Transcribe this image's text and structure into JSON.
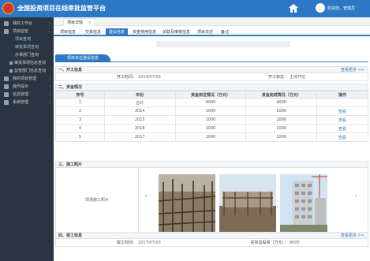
{
  "header": {
    "title": "全国投资项目在线审批监管平台",
    "user": "欢迎您，管理员"
  },
  "sidebar": {
    "items": [
      {
        "label": "我的工作台",
        "icon": "desktop-icon"
      },
      {
        "label": "项目监管",
        "icon": "monitor-icon"
      }
    ],
    "sub_items": [
      "项目查询",
      "审批事项查询",
      "办事部门查询"
    ],
    "sub2_items": [
      "审批事项信息查询",
      "监管部门信息查询"
    ],
    "bottom_items": [
      {
        "label": "我的项目管理",
        "icon": "folder-icon"
      },
      {
        "label": "操作提示",
        "icon": "tips-icon"
      },
      {
        "label": "信息管理",
        "icon": "info-icon"
      },
      {
        "label": "系统管理",
        "icon": "gear-icon"
      }
    ]
  },
  "tabbar": {
    "page_tab": "项目详情",
    "close": "×"
  },
  "subtabs": [
    "项目信息",
    "交易信息",
    "建设信息",
    "资金使用信息",
    "关联及审核信息",
    "项目日志",
    "备注"
  ],
  "section_title": "项目单位建设信息",
  "start": {
    "heading": "一、开工信息",
    "more": "查看更多 >>",
    "date_label": "开工时间：",
    "date_value": "2014/07/03",
    "person_label": "开工标志：",
    "person_value": "主体开挖"
  },
  "fund": {
    "heading": "二、资金情况",
    "columns": [
      "序号",
      "年份",
      "资金到位情况（万元）",
      "资金完成情况（万元）",
      "操作"
    ],
    "rows": [
      [
        "1",
        "合计",
        "4000",
        "4000",
        ""
      ],
      [
        "2",
        "2014",
        "1000",
        "1000",
        "查看"
      ],
      [
        "3",
        "2015",
        "1000",
        "1000",
        "查看"
      ],
      [
        "4",
        "2016",
        "1000",
        "1000",
        "查看"
      ],
      [
        "5",
        "2017",
        "1000",
        "1000",
        "查看"
      ]
    ]
  },
  "photos": {
    "heading": "三、施工照片",
    "label": "现场施工照片",
    "prev": "‹",
    "next": "›"
  },
  "finish": {
    "heading": "四、竣工信息",
    "more": "查看更多 >>",
    "date_label": "竣工时间：",
    "date_value": "2017/07/03",
    "amount_label": "实际总投资（万元）：",
    "amount_value": "4000"
  },
  "colors": {
    "primary": "#2d78c4",
    "sidebar": "#2b3542"
  }
}
